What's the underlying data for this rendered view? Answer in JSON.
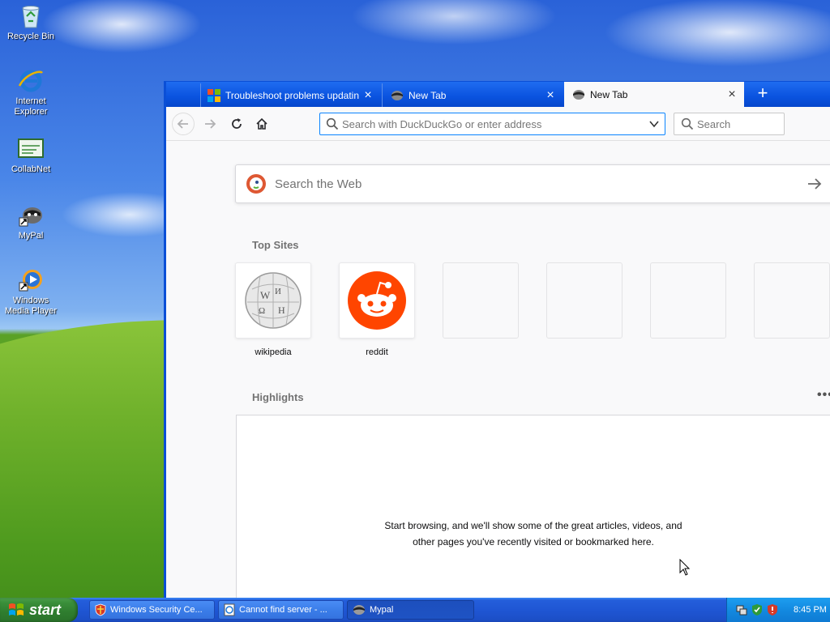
{
  "desktop": {
    "icons": [
      {
        "label": "Recycle Bin",
        "icon": "recycle-bin-icon"
      },
      {
        "label": "Internet Explorer",
        "icon": "internet-explorer-icon"
      },
      {
        "label": "CollabNet",
        "icon": "collabnet-icon"
      },
      {
        "label": "MyPal",
        "icon": "mypal-icon"
      },
      {
        "label": "Windows Media Player",
        "icon": "windows-media-player-icon"
      }
    ]
  },
  "browser": {
    "tabs": [
      {
        "title": "Troubleshoot problems updating W",
        "icon": "microsoft-logo-icon",
        "active": false
      },
      {
        "title": "New Tab",
        "icon": "mypal-icon",
        "active": false
      },
      {
        "title": "New Tab",
        "icon": "mypal-icon",
        "active": true
      }
    ],
    "toolbar": {
      "url_placeholder": "Search with DuckDuckGo or enter address",
      "url_value": "",
      "search_placeholder": "Search"
    },
    "newtab": {
      "web_search_placeholder": "Search the Web",
      "top_sites_title": "Top Sites",
      "top_sites": [
        {
          "label": "wikipedia",
          "icon": "wikipedia-icon"
        },
        {
          "label": "reddit",
          "icon": "reddit-icon"
        },
        {
          "label": "",
          "icon": ""
        },
        {
          "label": "",
          "icon": ""
        },
        {
          "label": "",
          "icon": ""
        },
        {
          "label": "",
          "icon": ""
        }
      ],
      "highlights_title": "Highlights",
      "highlights_menu": "•••",
      "highlights_empty": "Start browsing, and we'll show some of the great articles, videos, and other pages you've recently visited or bookmarked here."
    }
  },
  "taskbar": {
    "start_label": "start",
    "items": [
      {
        "label": "Windows Security Ce...",
        "icon": "security-shield-icon",
        "active": false
      },
      {
        "label": "Cannot find server - ...",
        "icon": "ie-page-icon",
        "active": false
      },
      {
        "label": "Mypal",
        "icon": "mypal-icon",
        "active": true
      }
    ],
    "clock": "8:45 PM"
  },
  "colors": {
    "taskbar_blue": "#245edb",
    "start_green": "#3a8f3a",
    "url_focus": "#0a84ff",
    "reddit_orange": "#ff4500",
    "ddg_orange": "#de5833"
  }
}
